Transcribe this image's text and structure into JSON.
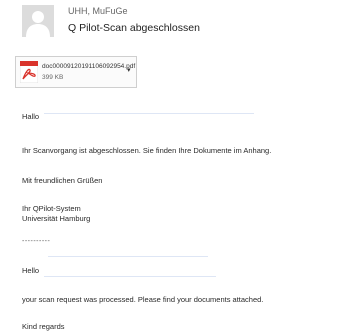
{
  "email": {
    "sender": "UHH, MuFuGe",
    "subject": "Q Pilot-Scan abgeschlossen",
    "attachment": {
      "icon": "pdf-icon",
      "filename": "doc00009120191106092954.pdf",
      "size": "399 KB",
      "menu_glyph": "▾"
    },
    "body": {
      "greeting_de": "Hallo",
      "text_de": "Ihr Scanvorgang ist abgeschlossen. Sie finden Ihre Dokumente im Anhang.",
      "closing_de": "Mit freundlichen Grüßen",
      "signature_line1": "Ihr QPilot-System",
      "signature_line2": "Universität Hamburg",
      "separator": "----------",
      "greeting_en": "Hello",
      "text_en": "your scan request was processed. Please find your documents attached.",
      "closing_en": "Kind regards"
    }
  },
  "colors": {
    "pdf_red": "#d9332b",
    "avatar_bg": "#dcdcdc"
  }
}
